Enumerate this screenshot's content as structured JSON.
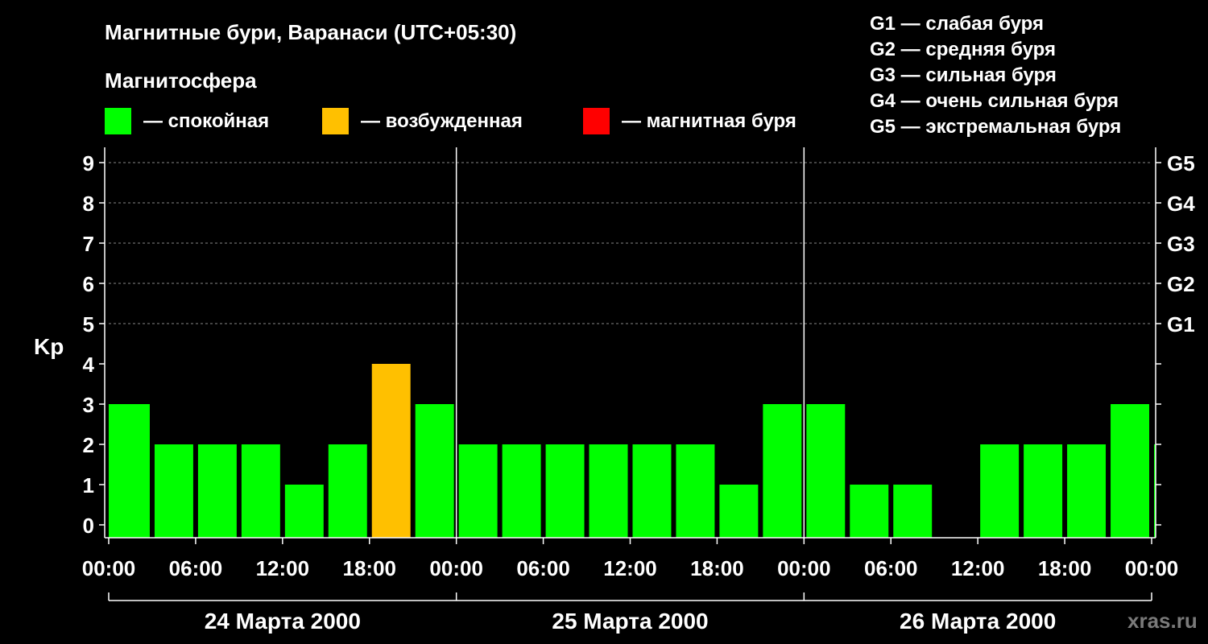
{
  "chart_data": {
    "type": "bar",
    "title": "Магнитные бури, Варанаси (UTC+05:30)",
    "ylabel": "Kp",
    "ylim": [
      0,
      9
    ],
    "y_ticks": [
      "0",
      "1",
      "2",
      "3",
      "4",
      "5",
      "6",
      "7",
      "8",
      "9"
    ],
    "right_axis_labels": [
      {
        "kp": 5,
        "label": "G1"
      },
      {
        "kp": 6,
        "label": "G2"
      },
      {
        "kp": 7,
        "label": "G3"
      },
      {
        "kp": 8,
        "label": "G4"
      },
      {
        "kp": 9,
        "label": "G5"
      }
    ],
    "grid": "dashed horizontal at Kp 5–9",
    "x_tick_labels": [
      "00:00",
      "06:00",
      "12:00",
      "18:00",
      "00:00",
      "06:00",
      "12:00",
      "18:00",
      "00:00",
      "06:00",
      "12:00",
      "18:00",
      "00:00"
    ],
    "days": [
      "24 Марта 2000",
      "25 Марта 2000",
      "26 Марта 2000"
    ],
    "bars": [
      {
        "day": 0,
        "start_hour": 0,
        "end_hour": 3,
        "kp": 3,
        "status": "calm"
      },
      {
        "day": 0,
        "start_hour": 3,
        "end_hour": 6,
        "kp": 2,
        "status": "calm"
      },
      {
        "day": 0,
        "start_hour": 6,
        "end_hour": 9,
        "kp": 2,
        "status": "calm"
      },
      {
        "day": 0,
        "start_hour": 9,
        "end_hour": 12,
        "kp": 2,
        "status": "calm"
      },
      {
        "day": 0,
        "start_hour": 12,
        "end_hour": 15,
        "kp": 1,
        "status": "calm"
      },
      {
        "day": 0,
        "start_hour": 15,
        "end_hour": 18,
        "kp": 2,
        "status": "calm"
      },
      {
        "day": 0,
        "start_hour": 18,
        "end_hour": 21,
        "kp": 4,
        "status": "excited"
      },
      {
        "day": 0,
        "start_hour": 21,
        "end_hour": 24,
        "kp": 3,
        "status": "calm"
      },
      {
        "day": 1,
        "start_hour": 0,
        "end_hour": 3,
        "kp": 2,
        "status": "calm"
      },
      {
        "day": 1,
        "start_hour": 3,
        "end_hour": 6,
        "kp": 2,
        "status": "calm"
      },
      {
        "day": 1,
        "start_hour": 6,
        "end_hour": 9,
        "kp": 2,
        "status": "calm"
      },
      {
        "day": 1,
        "start_hour": 9,
        "end_hour": 12,
        "kp": 2,
        "status": "calm"
      },
      {
        "day": 1,
        "start_hour": 12,
        "end_hour": 15,
        "kp": 2,
        "status": "calm"
      },
      {
        "day": 1,
        "start_hour": 15,
        "end_hour": 18,
        "kp": 2,
        "status": "calm"
      },
      {
        "day": 1,
        "start_hour": 18,
        "end_hour": 21,
        "kp": 1,
        "status": "calm"
      },
      {
        "day": 1,
        "start_hour": 21,
        "end_hour": 24,
        "kp": 3,
        "status": "calm"
      },
      {
        "day": 2,
        "start_hour": 0,
        "end_hour": 3,
        "kp": 3,
        "status": "calm"
      },
      {
        "day": 2,
        "start_hour": 3,
        "end_hour": 6,
        "kp": 1,
        "status": "calm"
      },
      {
        "day": 2,
        "start_hour": 6,
        "end_hour": 9,
        "kp": 1,
        "status": "calm"
      },
      {
        "day": 2,
        "start_hour": 9,
        "end_hour": 12,
        "kp": 0,
        "status": "calm"
      },
      {
        "day": 2,
        "start_hour": 12,
        "end_hour": 15,
        "kp": 2,
        "status": "calm"
      },
      {
        "day": 2,
        "start_hour": 15,
        "end_hour": 18,
        "kp": 2,
        "status": "calm"
      },
      {
        "day": 2,
        "start_hour": 18,
        "end_hour": 21,
        "kp": 2,
        "status": "calm"
      },
      {
        "day": 2,
        "start_hour": 21,
        "end_hour": 24,
        "kp": 3,
        "status": "calm"
      },
      {
        "day": 3,
        "start_hour": 0,
        "end_hour": 3,
        "kp": 2,
        "status": "calm"
      }
    ],
    "x_range_hours": [
      0,
      72
    ]
  },
  "legend": {
    "heading": "Магнитосфера",
    "items": [
      {
        "key": "calm",
        "label": "— спокойная",
        "color": "#00ff00"
      },
      {
        "key": "excited",
        "label": "— возбужденная",
        "color": "#ffc000"
      },
      {
        "key": "storm",
        "label": "— магнитная буря",
        "color": "#ff0000"
      }
    ]
  },
  "storm_scale": [
    "G1 — слабая буря",
    "G2 — средняя буря",
    "G3 — сильная буря",
    "G4 — очень сильная буря",
    "G5 — экстремальная буря"
  ],
  "watermark": "xras.ru",
  "colors": {
    "background": "#000000",
    "text": "#ffffff",
    "grid": "#888888",
    "calm": "#00ff00",
    "excited": "#ffc000",
    "storm": "#ff0000"
  }
}
